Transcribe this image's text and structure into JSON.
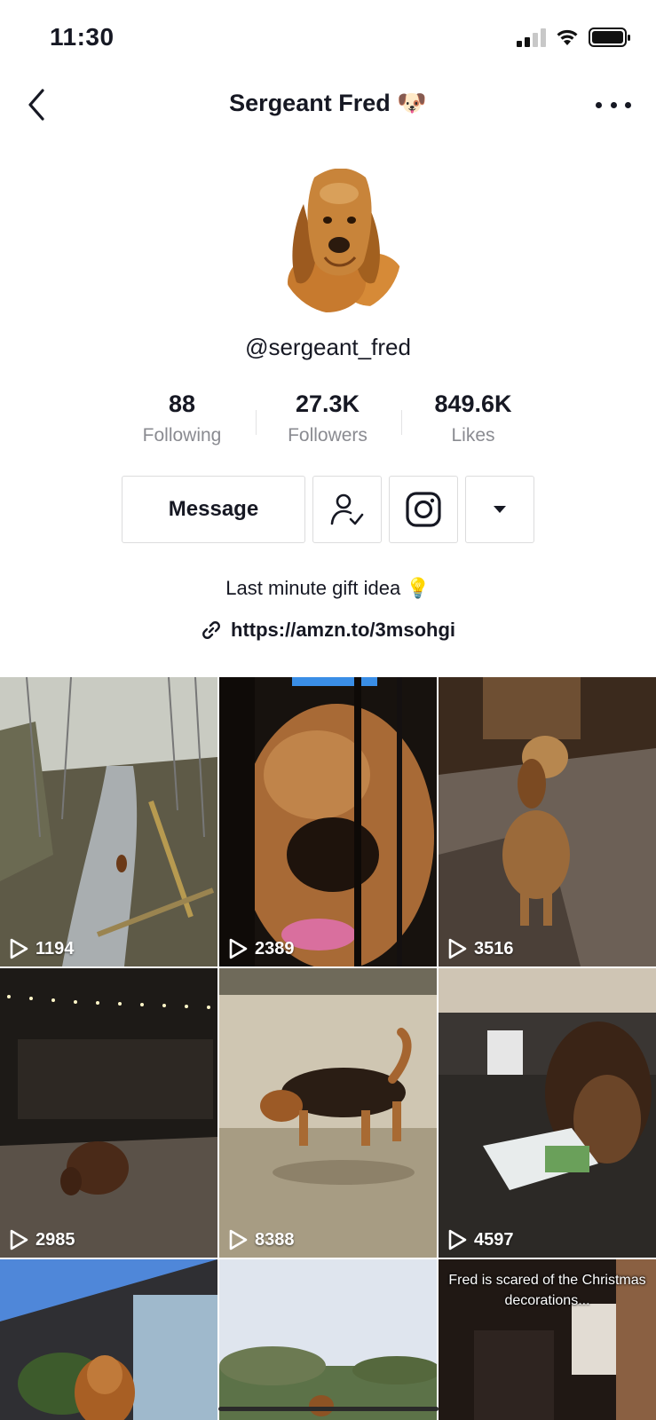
{
  "status_bar": {
    "time": "11:30"
  },
  "nav": {
    "title": "Sergeant Fred 🐶"
  },
  "profile": {
    "handle": "@sergeant_fred",
    "stats": [
      {
        "value": "88",
        "label": "Following"
      },
      {
        "value": "27.3K",
        "label": "Followers"
      },
      {
        "value": "849.6K",
        "label": "Likes"
      }
    ],
    "message_label": "Message",
    "bio": "Last minute gift idea 💡",
    "link": "https://amzn.to/3msohgi"
  },
  "videos": [
    {
      "views": "1194",
      "caption": ""
    },
    {
      "views": "2389",
      "caption": ""
    },
    {
      "views": "3516",
      "caption": ""
    },
    {
      "views": "2985",
      "caption": ""
    },
    {
      "views": "8388",
      "caption": ""
    },
    {
      "views": "4597",
      "caption": ""
    },
    {
      "views": "",
      "caption": ""
    },
    {
      "views": "",
      "caption": ""
    },
    {
      "views": "",
      "caption": "Fred is scared of the Christmas decorations..."
    }
  ]
}
